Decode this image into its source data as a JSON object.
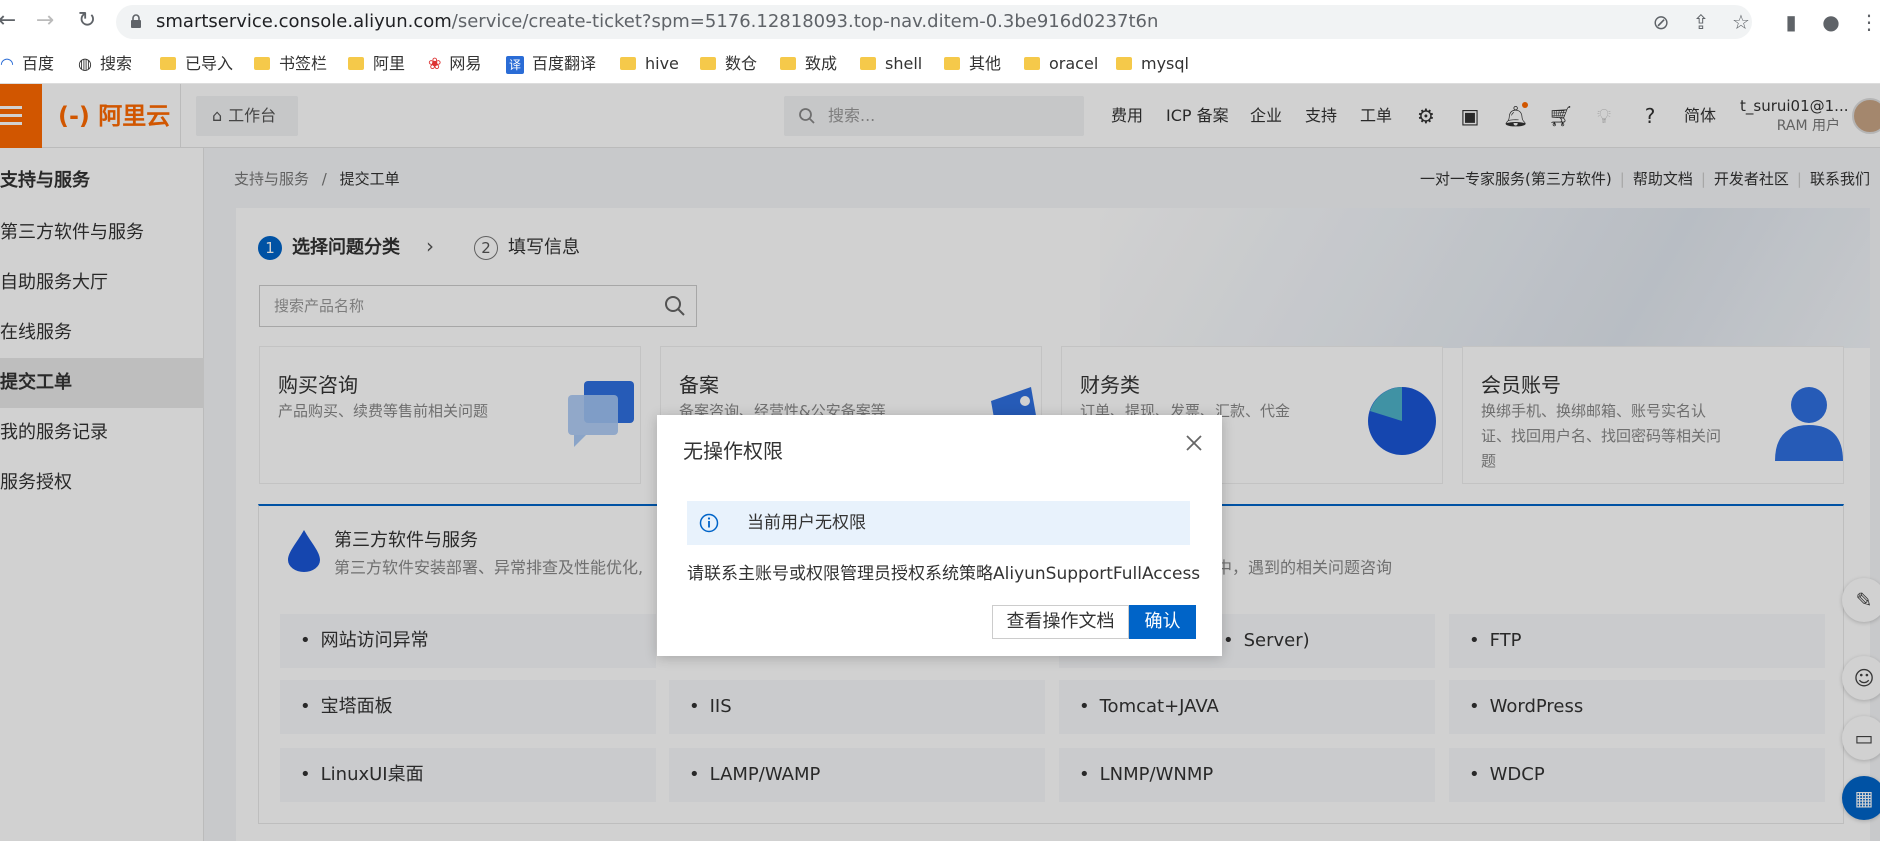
{
  "browser": {
    "url_host": "smartservice.console.aliyun.com",
    "url_path": "/service/create-ticket?spm=5176.12818093.top-nav.ditem-0.3be916d0237t6n",
    "bookmarks": [
      "百度",
      "搜索",
      "已导入",
      "书签栏",
      "阿里",
      "网易",
      "百度翻译",
      "hive",
      "数仓",
      "致成",
      "shell",
      "其他",
      "oracel",
      "mysql"
    ]
  },
  "header": {
    "logo": "(-) 阿里云",
    "workbench": "工作台",
    "search_placeholder": "搜索...",
    "nav": [
      "费用",
      "ICP 备案",
      "企业",
      "支持",
      "工单"
    ],
    "lang": "简体",
    "user_name": "t_surui01@1...",
    "user_role": "RAM 用户"
  },
  "sidebar": {
    "title": "支持与服务",
    "items": [
      "第三方软件与服务",
      "自助服务大厅",
      "在线服务",
      "提交工单",
      "我的服务记录",
      "服务授权"
    ],
    "active": "提交工单"
  },
  "breadcrumb": {
    "root": "支持与服务",
    "sep": "/",
    "current": "提交工单"
  },
  "help_links": [
    "一对一专家服务(第三方软件)",
    "帮助文档",
    "开发者社区",
    "联系我们"
  ],
  "steps": [
    {
      "num": "1",
      "label": "选择问题分类"
    },
    {
      "num": "2",
      "label": "填写信息"
    }
  ],
  "product_search_placeholder": "搜索产品名称",
  "categories": [
    {
      "title": "购买咨询",
      "desc": "产品购买、续费等售前相关问题"
    },
    {
      "title": "备案",
      "desc": "备案咨询、经营性&公安备案等"
    },
    {
      "title": "财务类",
      "desc": "订单、提现、发票、汇款、代金"
    },
    {
      "title": "会员账号",
      "desc": "换绑手机、换绑邮箱、账号实名认证、找回用户名、找回密码等相关问题"
    }
  ],
  "panel": {
    "title": "第三方软件与服务",
    "desc": "第三方软件安装部署、异常排查及性能优化,",
    "desc_right": "程中，遇到的相关问题咨询",
    "options": [
      [
        "网站访问异常",
        "",
        "Server)",
        "FTP"
      ],
      [
        "宝塔面板",
        "IIS",
        "Tomcat+JAVA",
        "WordPress"
      ],
      [
        "LinuxUI桌面",
        "LAMP/WAMP",
        "LNMP/WNMP",
        "WDCP"
      ]
    ]
  },
  "modal": {
    "title": "无操作权限",
    "alert": "当前用户无权限",
    "message": "请联系主账号或权限管理员授权系统策略AliyunSupportFullAccess",
    "btn_docs": "查看操作文档",
    "btn_ok": "确认"
  },
  "colors": {
    "brand": "#ff6a00",
    "primary": "#0064c8"
  }
}
